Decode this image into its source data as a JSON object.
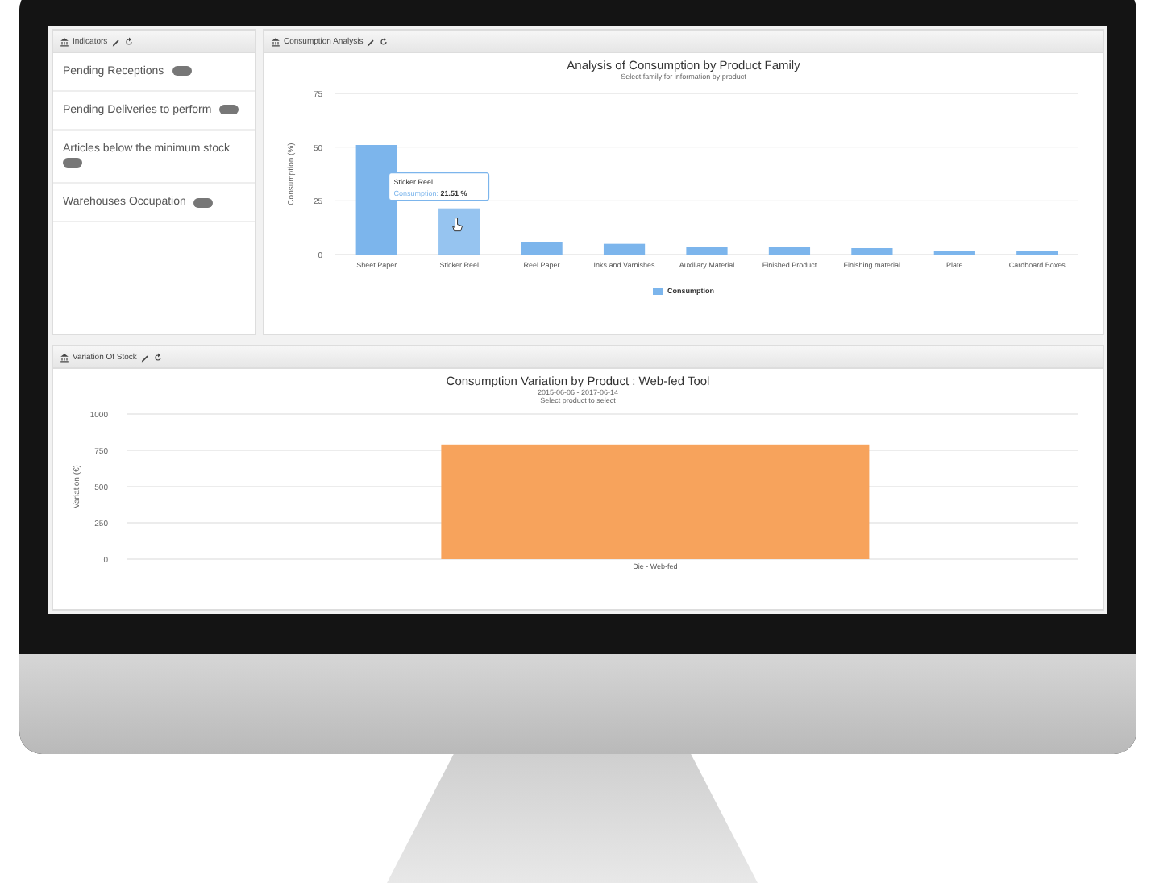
{
  "indicators": {
    "title": "Indicators",
    "items": [
      {
        "label": "Pending Receptions"
      },
      {
        "label": "Pending Deliveries to perform"
      },
      {
        "label": "Articles below the minimum stock"
      },
      {
        "label": "Warehouses Occupation"
      }
    ]
  },
  "consumption_analysis": {
    "title": "Consumption Analysis",
    "tooltip": {
      "title": "Sticker Reel",
      "label": "Consumption:",
      "value": "21.51 %"
    },
    "chart_data": {
      "type": "bar",
      "title": "Analysis of Consumption by Product Family",
      "subtitle": "Select family for information by product",
      "ylabel": "Consumption (%)",
      "categories": [
        "Sheet Paper",
        "Sticker Reel",
        "Reel Paper",
        "Inks and Varnishes",
        "Auxiliary Material",
        "Finished Product",
        "Finishing material",
        "Plate",
        "Cardboard Boxes"
      ],
      "series": [
        {
          "name": "Consumption",
          "color": "#7cb5ec",
          "values": [
            51,
            21.5,
            6,
            5,
            3.5,
            3.5,
            3,
            1.5,
            1.5
          ]
        }
      ],
      "ylim": [
        0,
        75
      ],
      "yticks": [
        0,
        25,
        50,
        75
      ],
      "grid": true
    }
  },
  "variation_of_stock": {
    "title": "Variation Of Stock",
    "chart_hint": "Select product to select",
    "chart_data": {
      "type": "bar",
      "title": "Consumption Variation by Product : Web-fed Tool",
      "subtitle": "2015-06-06 - 2017-06-14",
      "ylabel": "Variation (€)",
      "categories": [
        "Die - Web-fed"
      ],
      "series": [
        {
          "color": "#f7a35c",
          "values": [
            790
          ]
        }
      ],
      "ylim": [
        0,
        1000
      ],
      "yticks": [
        0,
        250,
        500,
        750,
        1000
      ],
      "grid": true
    }
  }
}
